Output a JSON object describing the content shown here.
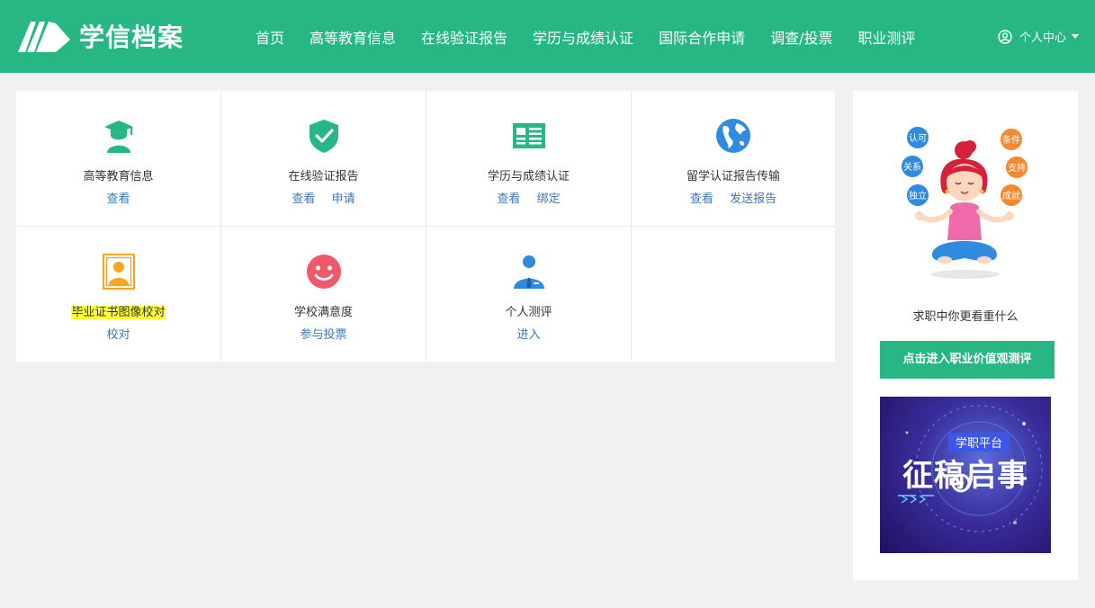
{
  "header": {
    "logo_text": "学信档案",
    "nav": [
      "首页",
      "高等教育信息",
      "在线验证报告",
      "学历与成绩认证",
      "国际合作申请",
      "调查/投票",
      "职业测评"
    ],
    "user_center": "个人中心"
  },
  "grid": [
    {
      "title": "高等教育信息",
      "links": [
        "查看"
      ],
      "icon": "graduate-icon"
    },
    {
      "title": "在线验证报告",
      "links": [
        "查看",
        "申请"
      ],
      "icon": "shield-check-icon"
    },
    {
      "title": "学历与成绩认证",
      "links": [
        "查看",
        "绑定"
      ],
      "icon": "document-icon"
    },
    {
      "title": "留学认证报告传输",
      "links": [
        "查看",
        "发送报告"
      ],
      "icon": "globe-icon"
    },
    {
      "title": "毕业证书图像校对",
      "links": [
        "校对"
      ],
      "icon": "portrait-icon"
    },
    {
      "title": "学校满意度",
      "links": [
        "参与投票"
      ],
      "icon": "smile-icon"
    },
    {
      "title": "个人测评",
      "links": [
        "进入"
      ],
      "icon": "person-tie-icon"
    }
  ],
  "side": {
    "bubbles": [
      "认可",
      "关系",
      "独立",
      "条件",
      "支持",
      "成就"
    ],
    "caption": "求职中你更看重什么",
    "cta": "点击进入职业价值观测评",
    "banner_tag": "学职平台",
    "banner_title": "征稿启事"
  },
  "colors": {
    "brand": "#27b783",
    "link": "#3a78b8",
    "highlight": "#ffff33"
  }
}
